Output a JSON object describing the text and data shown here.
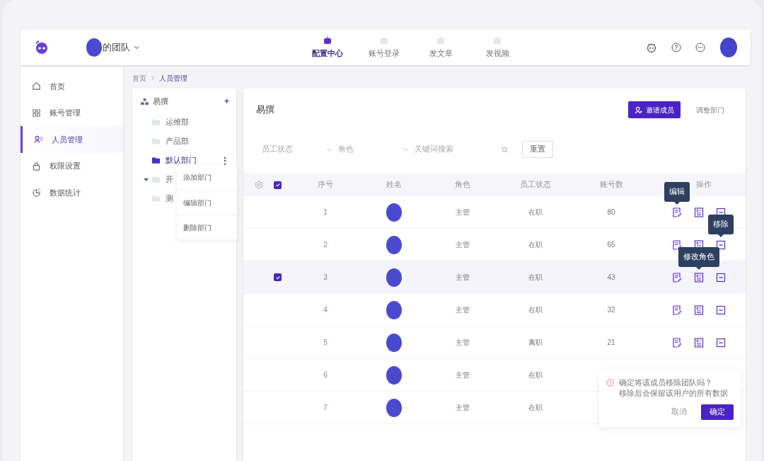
{
  "header": {
    "team_name": "的团队",
    "nav": [
      {
        "label": "配置中心",
        "selected": true
      },
      {
        "label": "账号登录",
        "selected": false
      },
      {
        "label": "发文章",
        "selected": false
      },
      {
        "label": "发视频",
        "selected": false
      }
    ]
  },
  "sidebar": {
    "items": [
      {
        "label": "首页",
        "selected": false
      },
      {
        "label": "账号管理",
        "selected": false
      },
      {
        "label": "人员管理",
        "selected": true
      },
      {
        "label": "权限设置",
        "selected": false
      },
      {
        "label": "数据统计",
        "selected": false
      }
    ]
  },
  "breadcrumb": [
    "首页",
    "人员管理"
  ],
  "tree": {
    "root": "易撰",
    "add": "+",
    "children": [
      {
        "label": "运维部",
        "selected": false
      },
      {
        "label": "产品部",
        "selected": false
      },
      {
        "label": "默认部门",
        "selected": true,
        "more": "⋮"
      },
      {
        "label": "开",
        "selected": false,
        "expanded": true
      },
      {
        "label": "测",
        "selected": false
      }
    ],
    "context_menu": [
      "添加部门",
      "编辑部门",
      "删除部门"
    ]
  },
  "main": {
    "title": "易撰",
    "buttons": [
      {
        "kind": "primary",
        "label": "邀请成员"
      },
      {
        "kind": "plain",
        "label": "调整部门"
      }
    ],
    "filters": [
      {
        "kind": "select",
        "placeholder": "员工状态"
      },
      {
        "kind": "select",
        "placeholder": "角色"
      },
      {
        "kind": "search",
        "placeholder": "关键词搜索"
      }
    ],
    "reset": "重置",
    "table": {
      "select_all": true,
      "columns": [
        "序号",
        "姓名",
        "角色",
        "员工状态",
        "账号数",
        "操作"
      ],
      "rows": [
        {
          "no": "1",
          "role": "主管",
          "status": "在职",
          "accounts": "80",
          "checked": false,
          "tooltip": {
            "kind": "edit",
            "text": "编辑"
          }
        },
        {
          "no": "2",
          "role": "主管",
          "status": "在职",
          "accounts": "65",
          "checked": false,
          "tooltip": {
            "kind": "remove",
            "text": "移除"
          }
        },
        {
          "no": "3",
          "role": "主管",
          "status": "在职",
          "accounts": "43",
          "checked": true,
          "tooltip": {
            "kind": "role",
            "text": "修改角色"
          }
        },
        {
          "no": "4",
          "role": "主管",
          "status": "在职",
          "accounts": "32",
          "checked": false
        },
        {
          "no": "5",
          "role": "主管",
          "status": "离职",
          "accounts": "21",
          "checked": false,
          "popconfirm": {
            "lines": [
              "确定将该成员移除团队吗？",
              "移除后会保留该用户的所有数据"
            ],
            "cancel": "取消",
            "confirm": "确定"
          }
        },
        {
          "no": "6",
          "role": "主管",
          "status": "在职",
          "checked": false
        },
        {
          "no": "7",
          "role": "主管",
          "status": "在职",
          "checked": false
        }
      ]
    }
  }
}
